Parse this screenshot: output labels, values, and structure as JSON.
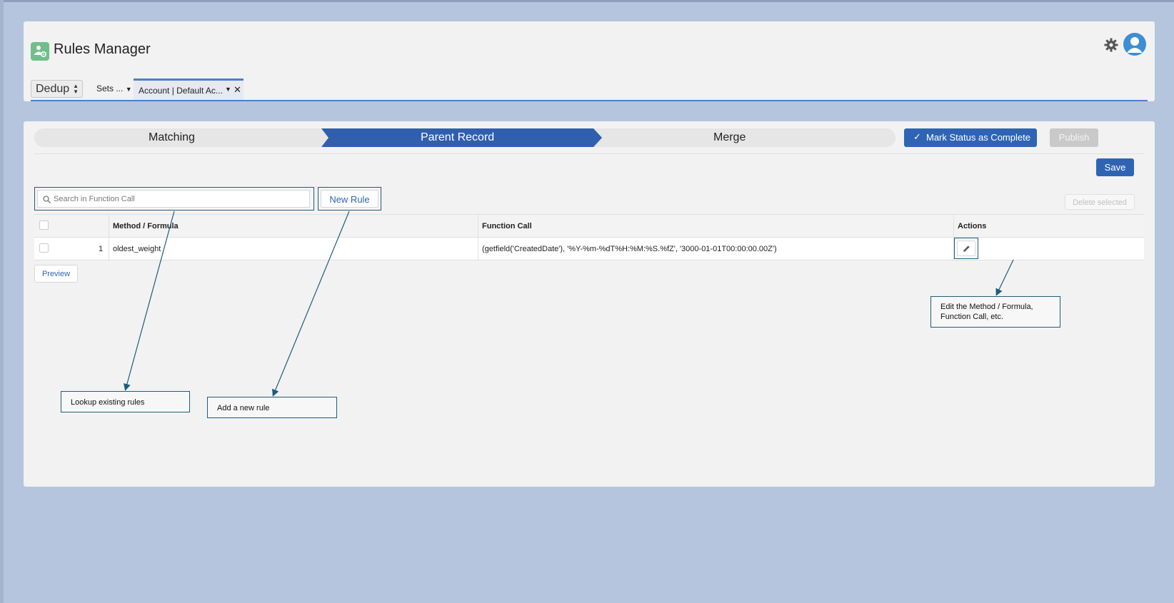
{
  "header": {
    "title": "Rules Manager",
    "dedup_select": "Dedup",
    "tabs": [
      {
        "label": "Sets ..."
      },
      {
        "label": "Account | Default Ac..."
      }
    ]
  },
  "steps": [
    {
      "label": "Matching"
    },
    {
      "label": "Parent Record",
      "active": true
    },
    {
      "label": "Merge"
    }
  ],
  "toolbar": {
    "mark_complete_label": "Mark Status as Complete",
    "publish_label": "Publish",
    "save_label": "Save",
    "new_rule_label": "New Rule",
    "delete_selected_label": "Delete selected",
    "preview_label": "Preview"
  },
  "search": {
    "placeholder": "Search in Function Call",
    "value": ""
  },
  "table": {
    "columns": [
      "Method / Formula",
      "Function Call",
      "Actions"
    ],
    "rows": [
      {
        "index": "1",
        "method": "oldest_weight",
        "function_call": "(getfield('CreatedDate'), '%Y-%m-%dT%H:%M:%S.%fZ', '3000-01-01T00:00:00.00Z')"
      }
    ]
  },
  "annotations": {
    "lookup": "Lookup existing rules",
    "add": "Add a new rule",
    "edit": "Edit the Method / Formula, Function Call, etc."
  },
  "colors": {
    "accent": "#2f64b5",
    "background": "#b5c5dd",
    "callout_border": "#1e5d7a",
    "app_icon": "#6fbf8a"
  }
}
